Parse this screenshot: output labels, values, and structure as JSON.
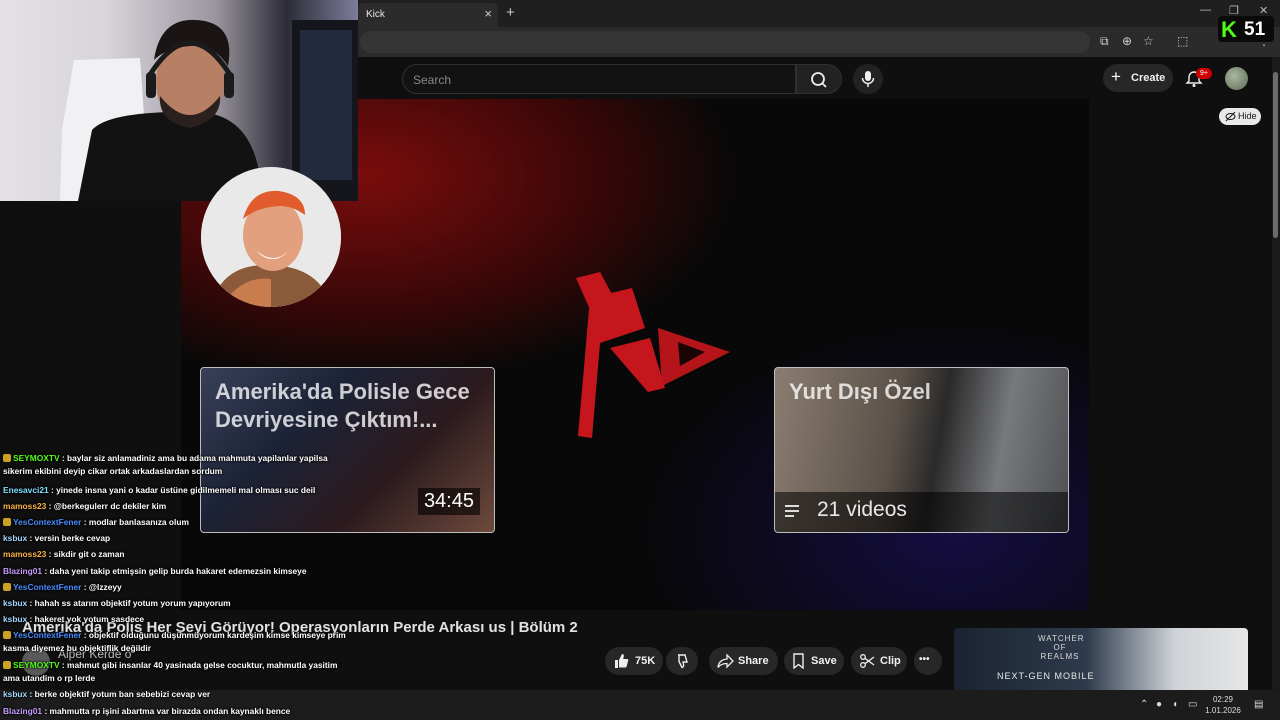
{
  "browser": {
    "tab_title": "Kick",
    "tab_close": "×",
    "new_tab": "+",
    "min": "—",
    "max": "❐",
    "close": "✕"
  },
  "kick_badge": {
    "logo": "K",
    "viewers": "51"
  },
  "youtube": {
    "search_placeholder": "Search",
    "create_label": "Create",
    "notifications": "9+",
    "hide_label": "Hide"
  },
  "video": {
    "endcards": [
      {
        "title": "Amerika'da Polisle Gece Devriyesine Çıktım!...",
        "duration": "34:45"
      },
      {
        "title": "Yurt Dışı Özel",
        "playlist_count": "21 videos"
      }
    ],
    "title": "Amerika'da Polis Her Şeyi Görüyor! Operasyonların Perde Arkası us | Bölüm 2",
    "channel": "Alper Kerde o"
  },
  "actions": {
    "likes": "75K",
    "share": "Share",
    "save": "Save",
    "clip": "Clip",
    "more": "•••"
  },
  "ad": {
    "brand": "WATCHER OF REALMS",
    "tagline": "NEXT-GEN MOBILE"
  },
  "taskbar": {
    "time": "02:29",
    "date": "1.01.2026"
  },
  "chat": [
    {
      "user": "SEYMOXTV",
      "color": "#53fc18",
      "text": ": baylar siz anlamadiniz ama bu adama mahmuta yapilanlar yapilsa sikerim ekibini deyip cikar ortak arkadaslardan sordum",
      "badge": "#c9a227"
    },
    {
      "user": "Enesavci21",
      "color": "#7fe0ff",
      "text": ": yinede insna yani o kadar üstüne gidilmemeli mal olması suc deil"
    },
    {
      "user": "mamoss23",
      "color": "#ffb347",
      "text": ": @berkegulerr dc dekiler kim"
    },
    {
      "user": "YesContextFener",
      "color": "#4a8cff",
      "text": ": modlar banlasanıza olum",
      "badge": "#c9a227"
    },
    {
      "user": "ksbux",
      "color": "#9fd7ff",
      "text": ": versin berke cevap"
    },
    {
      "user": "mamoss23",
      "color": "#ffb347",
      "text": ": sikdir git o zaman"
    },
    {
      "user": "Blazing01",
      "color": "#c89bff",
      "text": ": daha yeni takip etmişsin gelip burda hakaret edemezsin kimseye"
    },
    {
      "user": "YesContextFener",
      "color": "#4a8cff",
      "text": ": @lzzeyy",
      "badge": "#c9a227"
    },
    {
      "user": "ksbux",
      "color": "#9fd7ff",
      "text": ": hahah ss atarım objektif yotum yorum yapıyorum"
    },
    {
      "user": "ksbux",
      "color": "#9fd7ff",
      "text": ": hakeret yok yotum sasdece"
    },
    {
      "user": "YesContextFener",
      "color": "#4a8cff",
      "text": ": objektif olduğunu düşünmüyorum kardeşim kimse kimseye prim kasma diyemez bu objektiflik değildir",
      "badge": "#c9a227"
    },
    {
      "user": "SEYMOXTV",
      "color": "#53fc18",
      "text": ": mahmut gibi insanlar 40 yasinada gelse cocuktur, mahmutla yasitim ama utandim o rp lerde",
      "badge": "#c9a227"
    },
    {
      "user": "ksbux",
      "color": "#9fd7ff",
      "text": ": berke objektif yotum ban sebebizi cevap ver"
    },
    {
      "user": "Blazing01",
      "color": "#c89bff",
      "text": ": mahmutta rp işini abartma var birazda ondan kaynaklı bence"
    }
  ]
}
